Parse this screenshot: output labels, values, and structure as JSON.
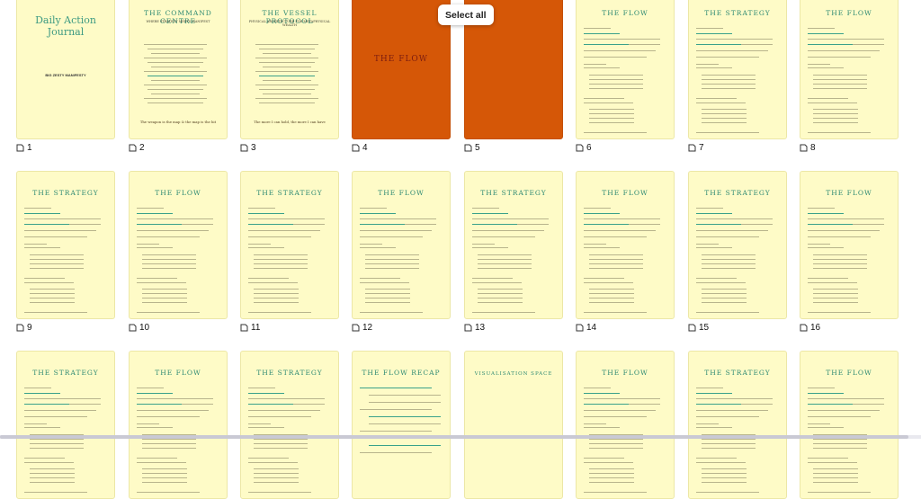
{
  "toolbar": {
    "select_all_label": "Select all"
  },
  "pages": [
    {
      "number": "1",
      "kind": "cover",
      "title": "Daily Action Journal",
      "subtitle": "BIG ZESTY MANIFESTY",
      "quote": ""
    },
    {
      "number": "2",
      "kind": "text",
      "title": "THE COMMAND CENTRE",
      "subtitle": "WHERE STRATEGY MEETS MANIFEST",
      "quote": "The weapon is the map & the map is the hit"
    },
    {
      "number": "3",
      "kind": "text",
      "title": "THE VESSEL PROTOCOL",
      "subtitle": "PHYSICAL ARCHITECTURE FOR METAPHYSICAL WEALTH",
      "quote": "The more I can hold, the more I can have"
    },
    {
      "number": "4",
      "kind": "orange",
      "title": "THE FLOW",
      "subtitle": "",
      "quote": ""
    },
    {
      "number": "5",
      "kind": "orange",
      "title": "",
      "subtitle": "",
      "quote": ""
    },
    {
      "number": "6",
      "kind": "flow",
      "title": "THE FLOW",
      "subtitle": "",
      "quote": ""
    },
    {
      "number": "7",
      "kind": "strategy",
      "title": "THE STRATEGY",
      "subtitle": "",
      "quote": ""
    },
    {
      "number": "8",
      "kind": "flow",
      "title": "THE FLOW",
      "subtitle": "",
      "quote": ""
    },
    {
      "number": "9",
      "kind": "strategy",
      "title": "THE STRATEGY",
      "subtitle": "",
      "quote": ""
    },
    {
      "number": "10",
      "kind": "flow",
      "title": "THE FLOW",
      "subtitle": "",
      "quote": ""
    },
    {
      "number": "11",
      "kind": "strategy",
      "title": "THE STRATEGY",
      "subtitle": "",
      "quote": ""
    },
    {
      "number": "12",
      "kind": "flow",
      "title": "THE FLOW",
      "subtitle": "",
      "quote": ""
    },
    {
      "number": "13",
      "kind": "strategy",
      "title": "THE STRATEGY",
      "subtitle": "",
      "quote": ""
    },
    {
      "number": "14",
      "kind": "flow",
      "title": "THE FLOW",
      "subtitle": "",
      "quote": ""
    },
    {
      "number": "15",
      "kind": "strategy",
      "title": "THE STRATEGY",
      "subtitle": "",
      "quote": ""
    },
    {
      "number": "16",
      "kind": "flow",
      "title": "THE FLOW",
      "subtitle": "",
      "quote": ""
    },
    {
      "number": "",
      "kind": "strategy",
      "title": "THE STRATEGY",
      "subtitle": "",
      "quote": ""
    },
    {
      "number": "",
      "kind": "flow",
      "title": "THE FLOW",
      "subtitle": "",
      "quote": ""
    },
    {
      "number": "",
      "kind": "strategy",
      "title": "THE STRATEGY",
      "subtitle": "",
      "quote": ""
    },
    {
      "number": "",
      "kind": "recap",
      "title": "THE FLOW RECAP",
      "subtitle": "",
      "quote": ""
    },
    {
      "number": "",
      "kind": "visual",
      "title": "VISUALISATION SPACE",
      "subtitle": "",
      "quote": ""
    },
    {
      "number": "",
      "kind": "flow",
      "title": "THE FLOW",
      "subtitle": "",
      "quote": ""
    },
    {
      "number": "",
      "kind": "strategy",
      "title": "THE STRATEGY",
      "subtitle": "",
      "quote": ""
    },
    {
      "number": "",
      "kind": "flow",
      "title": "THE FLOW",
      "subtitle": "",
      "quote": ""
    }
  ],
  "colors": {
    "page": "#fefbc7",
    "accent": "#d55707",
    "title": "#2e8a73"
  }
}
